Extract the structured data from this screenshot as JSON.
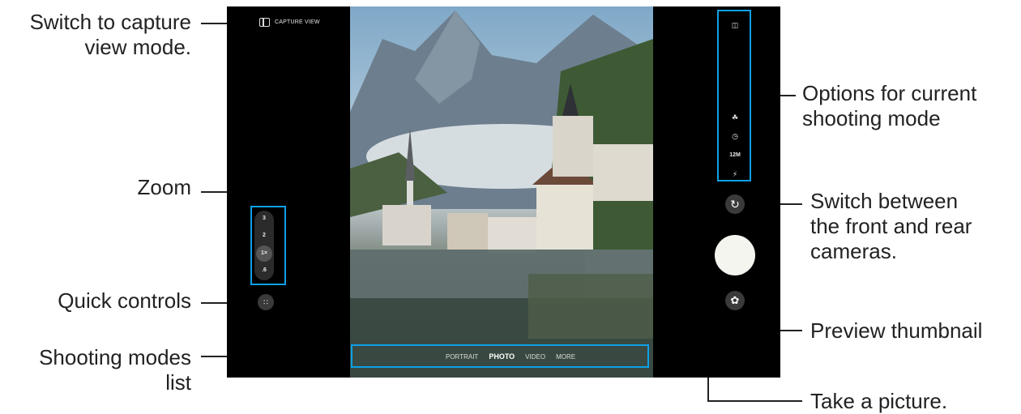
{
  "callouts": {
    "capture_view_line1": "Switch to capture",
    "capture_view_line2": "view mode.",
    "zoom": "Zoom",
    "quick_controls": "Quick controls",
    "modes_line1": "Shooting modes",
    "modes_line2": "list",
    "options_line1": "Options for current",
    "options_line2": "shooting mode",
    "switch_line1": "Switch between",
    "switch_line2": "the front and rear",
    "switch_line3": "cameras.",
    "preview": "Preview thumbnail",
    "take_picture": "Take a picture."
  },
  "camera": {
    "capture_view_label": "CAPTURE VIEW",
    "zoom_levels": [
      "3",
      "2",
      "1×",
      ".6"
    ],
    "selected_zoom": "1×",
    "modes": [
      "PORTRAIT",
      "PHOTO",
      "VIDEO",
      "MORE"
    ],
    "active_mode": "PHOTO",
    "options": {
      "ratio_icon": "◫",
      "filter_icon": "☘",
      "timer_icon": "◷",
      "resolution": "12M",
      "flash_icon": "⚡"
    },
    "quick_controls_icon": "∷",
    "switch_icon": "↻",
    "thumb_icon": "✿"
  },
  "colors": {
    "highlight": "#0ea0e6",
    "screen": "#000000"
  }
}
